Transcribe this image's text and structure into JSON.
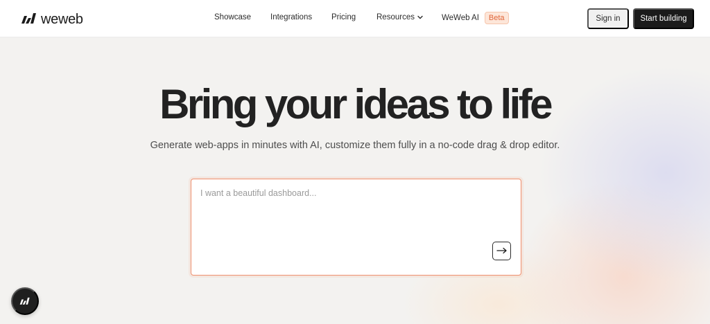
{
  "brand": {
    "name": "weweb",
    "logo_icon": "weweb-logo-icon"
  },
  "nav": {
    "items": [
      {
        "label": "Showcase"
      },
      {
        "label": "Integrations"
      },
      {
        "label": "Pricing"
      },
      {
        "label": "Resources",
        "icon": "chevron-down-icon"
      },
      {
        "label": "WeWeb AI",
        "badge": "Beta"
      }
    ]
  },
  "header_actions": {
    "sign_in": "Sign in",
    "start": "Start building"
  },
  "hero": {
    "title": "Bring your ideas to life",
    "subtitle": "Generate web-apps in minutes with AI, customize them fully in a no-code drag & drop editor."
  },
  "prompt": {
    "placeholder": "I want a beautiful dashboard...",
    "value": "",
    "submit_icon": "arrow-right-icon"
  },
  "chat_launcher": {
    "icon": "weweb-logo-icon"
  },
  "colors": {
    "accent": "#e0663a",
    "accent_border": "#ef8f6e",
    "dark": "#1b1b1b",
    "background": "#f3f2f0"
  }
}
